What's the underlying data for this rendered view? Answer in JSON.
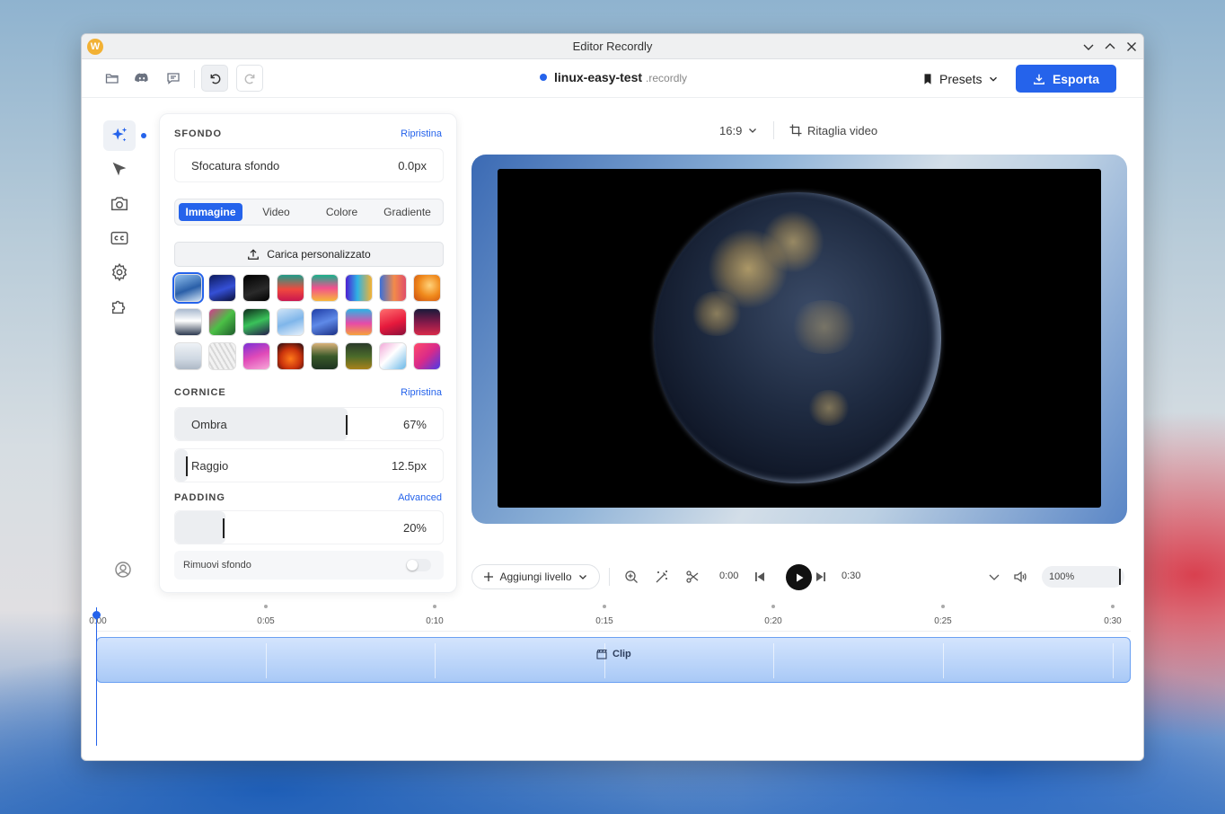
{
  "window": {
    "title": "Editor Recordly",
    "logo": "W"
  },
  "toolbar": {
    "project_name": "linux-easy-test",
    "project_ext": ".recordly",
    "presets_label": "Presets",
    "export_label": "Esporta"
  },
  "sidebar": {
    "items": [
      {
        "icon": "sparkles-icon",
        "active": true
      },
      {
        "icon": "cursor-icon"
      },
      {
        "icon": "camera-icon"
      },
      {
        "icon": "captions-icon"
      },
      {
        "icon": "settings-icon"
      },
      {
        "icon": "puzzle-icon"
      }
    ]
  },
  "panel": {
    "background": {
      "title": "SFONDO",
      "reset": "Ripristina",
      "blur_label": "Sfocatura sfondo",
      "blur_value": "0.0px",
      "tabs": [
        "Immagine",
        "Video",
        "Colore",
        "Gradiente"
      ],
      "active_tab": "Immagine",
      "upload_label": "Carica personalizzato"
    },
    "frame": {
      "title": "CORNICE",
      "reset": "Ripristina",
      "shadow_label": "Ombra",
      "shadow_value": "67%",
      "shadow_fraction": 0.67,
      "radius_label": "Raggio",
      "radius_value": "12.5px"
    },
    "padding": {
      "title": "PADDING",
      "link": "Advanced",
      "value": "20%",
      "fraction": 0.2,
      "remove_bg_label": "Rimuovi sfondo"
    }
  },
  "canvas": {
    "aspect_ratio": "16:9",
    "crop_label": "Ritaglia video"
  },
  "playback": {
    "add_layer_label": "Aggiungi livello",
    "current_time": "0:00",
    "duration": "0:30",
    "zoom": "100%"
  },
  "timeline": {
    "ticks": [
      "0:00",
      "0:05",
      "0:10",
      "0:15",
      "0:20",
      "0:25",
      "0:30"
    ],
    "clip_label": "Clip"
  },
  "colors": {
    "accent": "#2563eb"
  }
}
